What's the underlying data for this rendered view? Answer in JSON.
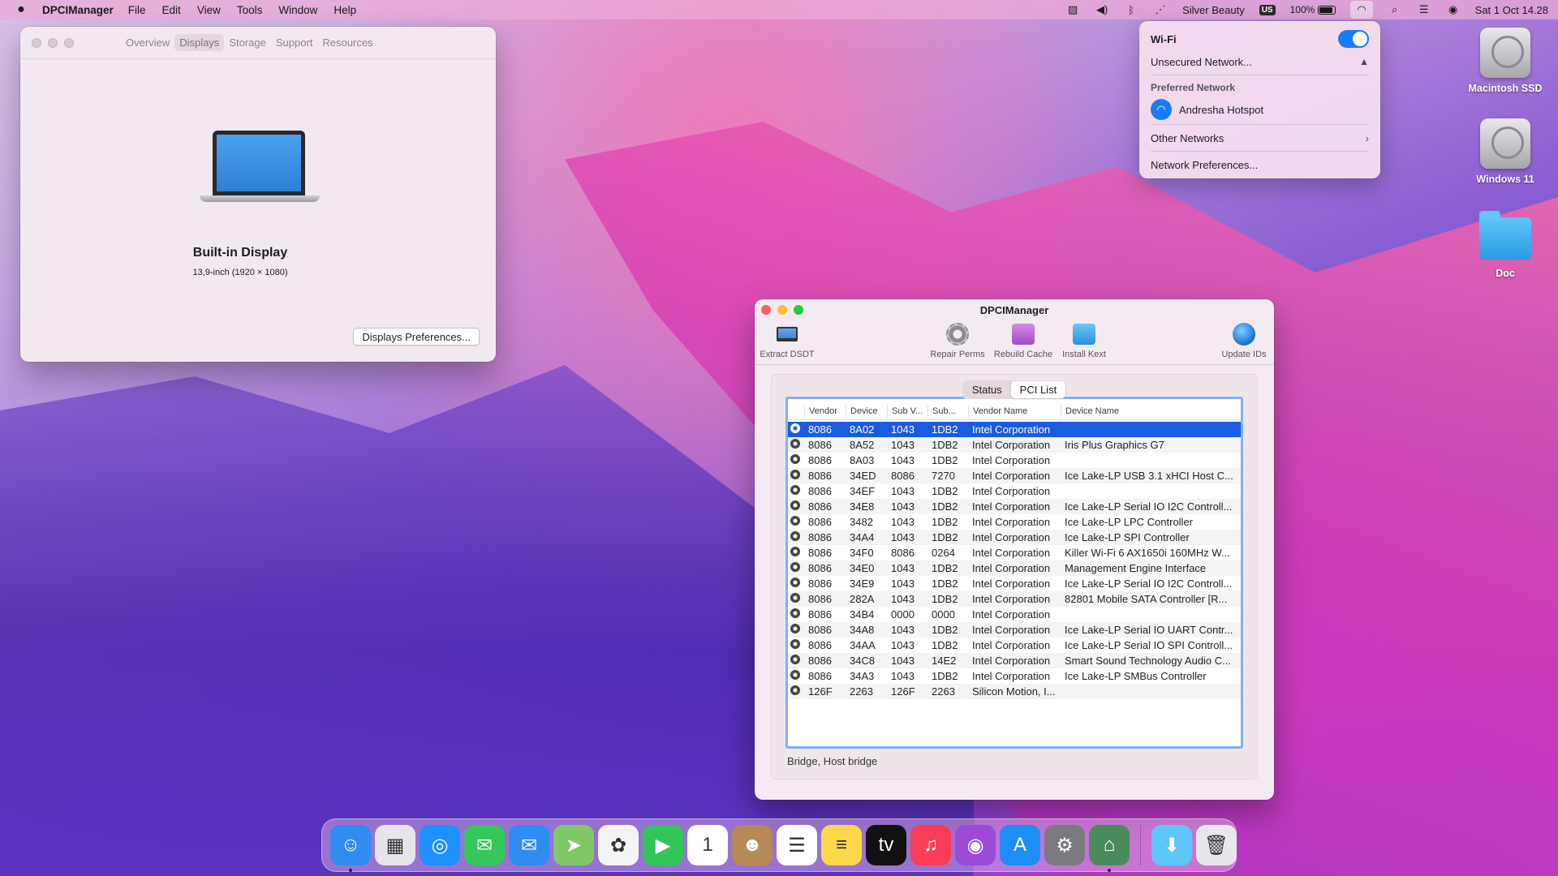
{
  "menubar": {
    "app_name": "DPCIManager",
    "menus": [
      "File",
      "Edit",
      "View",
      "Tools",
      "Window",
      "Help"
    ],
    "user": "Silver Beauty",
    "input_source": "US",
    "battery": "100%",
    "datetime": "Sat 1 Oct  14.28"
  },
  "wifi_menu": {
    "title": "Wi-Fi",
    "enabled": true,
    "unsecured": "Unsecured Network...",
    "preferred_label": "Preferred Network",
    "preferred_network": "Andresha Hotspot",
    "other_networks": "Other Networks",
    "preferences": "Network Preferences..."
  },
  "desktop": {
    "icons": [
      {
        "label": "Macintosh SSD",
        "icon": "hard-drive-icon"
      },
      {
        "label": "Windows 11",
        "icon": "hard-drive-icon"
      },
      {
        "label": "Doc",
        "icon": "folder-icon"
      }
    ]
  },
  "about_window": {
    "tabs": [
      "Overview",
      "Displays",
      "Storage",
      "Support",
      "Resources"
    ],
    "active_tab": "Displays",
    "display_name": "Built-in Display",
    "display_spec": "13,9-inch (1920 × 1080)",
    "prefs_button": "Displays Preferences..."
  },
  "dpci_window": {
    "title": "DPCIManager",
    "toolbar": {
      "extract": "Extract DSDT",
      "repair": "Repair Perms",
      "rebuild": "Rebuild Cache",
      "install": "Install Kext",
      "update": "Update IDs"
    },
    "tabs": [
      "Status",
      "PCI List"
    ],
    "active_tab": "PCI List",
    "columns": [
      "Vendor",
      "Device",
      "Sub V...",
      "Sub...",
      "Vendor Name",
      "Device Name"
    ],
    "rows": [
      [
        "8086",
        "8A02",
        "1043",
        "1DB2",
        "Intel Corporation",
        ""
      ],
      [
        "8086",
        "8A52",
        "1043",
        "1DB2",
        "Intel Corporation",
        "Iris Plus Graphics G7"
      ],
      [
        "8086",
        "8A03",
        "1043",
        "1DB2",
        "Intel Corporation",
        ""
      ],
      [
        "8086",
        "34ED",
        "8086",
        "7270",
        "Intel Corporation",
        "Ice Lake-LP USB 3.1 xHCI Host C..."
      ],
      [
        "8086",
        "34EF",
        "1043",
        "1DB2",
        "Intel Corporation",
        ""
      ],
      [
        "8086",
        "34E8",
        "1043",
        "1DB2",
        "Intel Corporation",
        "Ice Lake-LP Serial IO I2C Controll..."
      ],
      [
        "8086",
        "3482",
        "1043",
        "1DB2",
        "Intel Corporation",
        "Ice Lake-LP LPC Controller"
      ],
      [
        "8086",
        "34A4",
        "1043",
        "1DB2",
        "Intel Corporation",
        "Ice Lake-LP SPI Controller"
      ],
      [
        "8086",
        "34F0",
        "8086",
        "0264",
        "Intel Corporation",
        "Killer Wi-Fi 6 AX1650i 160MHz W..."
      ],
      [
        "8086",
        "34E0",
        "1043",
        "1DB2",
        "Intel Corporation",
        "Management Engine Interface"
      ],
      [
        "8086",
        "34E9",
        "1043",
        "1DB2",
        "Intel Corporation",
        "Ice Lake-LP Serial IO I2C Controll..."
      ],
      [
        "8086",
        "282A",
        "1043",
        "1DB2",
        "Intel Corporation",
        "82801 Mobile SATA Controller [R..."
      ],
      [
        "8086",
        "34B4",
        "0000",
        "0000",
        "Intel Corporation",
        ""
      ],
      [
        "8086",
        "34A8",
        "1043",
        "1DB2",
        "Intel Corporation",
        "Ice Lake-LP Serial IO UART Contr..."
      ],
      [
        "8086",
        "34AA",
        "1043",
        "1DB2",
        "Intel Corporation",
        "Ice Lake-LP Serial IO SPI Controll..."
      ],
      [
        "8086",
        "34C8",
        "1043",
        "14E2",
        "Intel Corporation",
        "Smart Sound Technology Audio C..."
      ],
      [
        "8086",
        "34A3",
        "1043",
        "1DB2",
        "Intel Corporation",
        "Ice Lake-LP SMBus Controller"
      ],
      [
        "126F",
        "2263",
        "126F",
        "2263",
        "Silicon Motion, I...",
        ""
      ]
    ],
    "selected_row": 0,
    "status": "Bridge, Host bridge"
  },
  "dock": {
    "apps": [
      {
        "icon": "finder-icon",
        "color": "#2f8cf0",
        "glyph": "☺",
        "running": true
      },
      {
        "icon": "launchpad-icon",
        "color": "#e6e6ea",
        "glyph": "▦",
        "running": false
      },
      {
        "icon": "safari-icon",
        "color": "#1e90ff",
        "glyph": "◎",
        "running": false
      },
      {
        "icon": "messages-icon",
        "color": "#34c759",
        "glyph": "✉",
        "running": false
      },
      {
        "icon": "mail-icon",
        "color": "#2f8cf0",
        "glyph": "✉",
        "running": false
      },
      {
        "icon": "maps-icon",
        "color": "#7fc96a",
        "glyph": "➤",
        "running": false
      },
      {
        "icon": "photos-icon",
        "color": "#f4f4f4",
        "glyph": "✿",
        "running": false
      },
      {
        "icon": "facetime-icon",
        "color": "#32c55a",
        "glyph": "▶",
        "running": false
      },
      {
        "icon": "calendar-icon",
        "color": "#ffffff",
        "glyph": "1",
        "running": false
      },
      {
        "icon": "contacts-icon",
        "color": "#b58a55",
        "glyph": "☻",
        "running": false
      },
      {
        "icon": "reminders-icon",
        "color": "#ffffff",
        "glyph": "☰",
        "running": false
      },
      {
        "icon": "notes-icon",
        "color": "#fcd94a",
        "glyph": "≡",
        "running": false
      },
      {
        "icon": "tv-icon",
        "color": "#111111",
        "glyph": "tv",
        "running": false
      },
      {
        "icon": "music-icon",
        "color": "#fa3c55",
        "glyph": "♫",
        "running": false
      },
      {
        "icon": "podcasts-icon",
        "color": "#9b4bd6",
        "glyph": "◉",
        "running": false
      },
      {
        "icon": "app-store-icon",
        "color": "#1c8ef5",
        "glyph": "A",
        "running": false
      },
      {
        "icon": "system-preferences-icon",
        "color": "#7a7a80",
        "glyph": "⚙",
        "running": false
      },
      {
        "icon": "dpcimanager-icon",
        "color": "#4a8b5c",
        "glyph": "⌂",
        "running": true
      }
    ],
    "trailing": [
      {
        "icon": "downloads-folder-icon",
        "color": "#5ec6f8",
        "glyph": "⬇"
      },
      {
        "icon": "trash-icon",
        "color": "#e8e8ec",
        "glyph": "🗑"
      }
    ]
  }
}
